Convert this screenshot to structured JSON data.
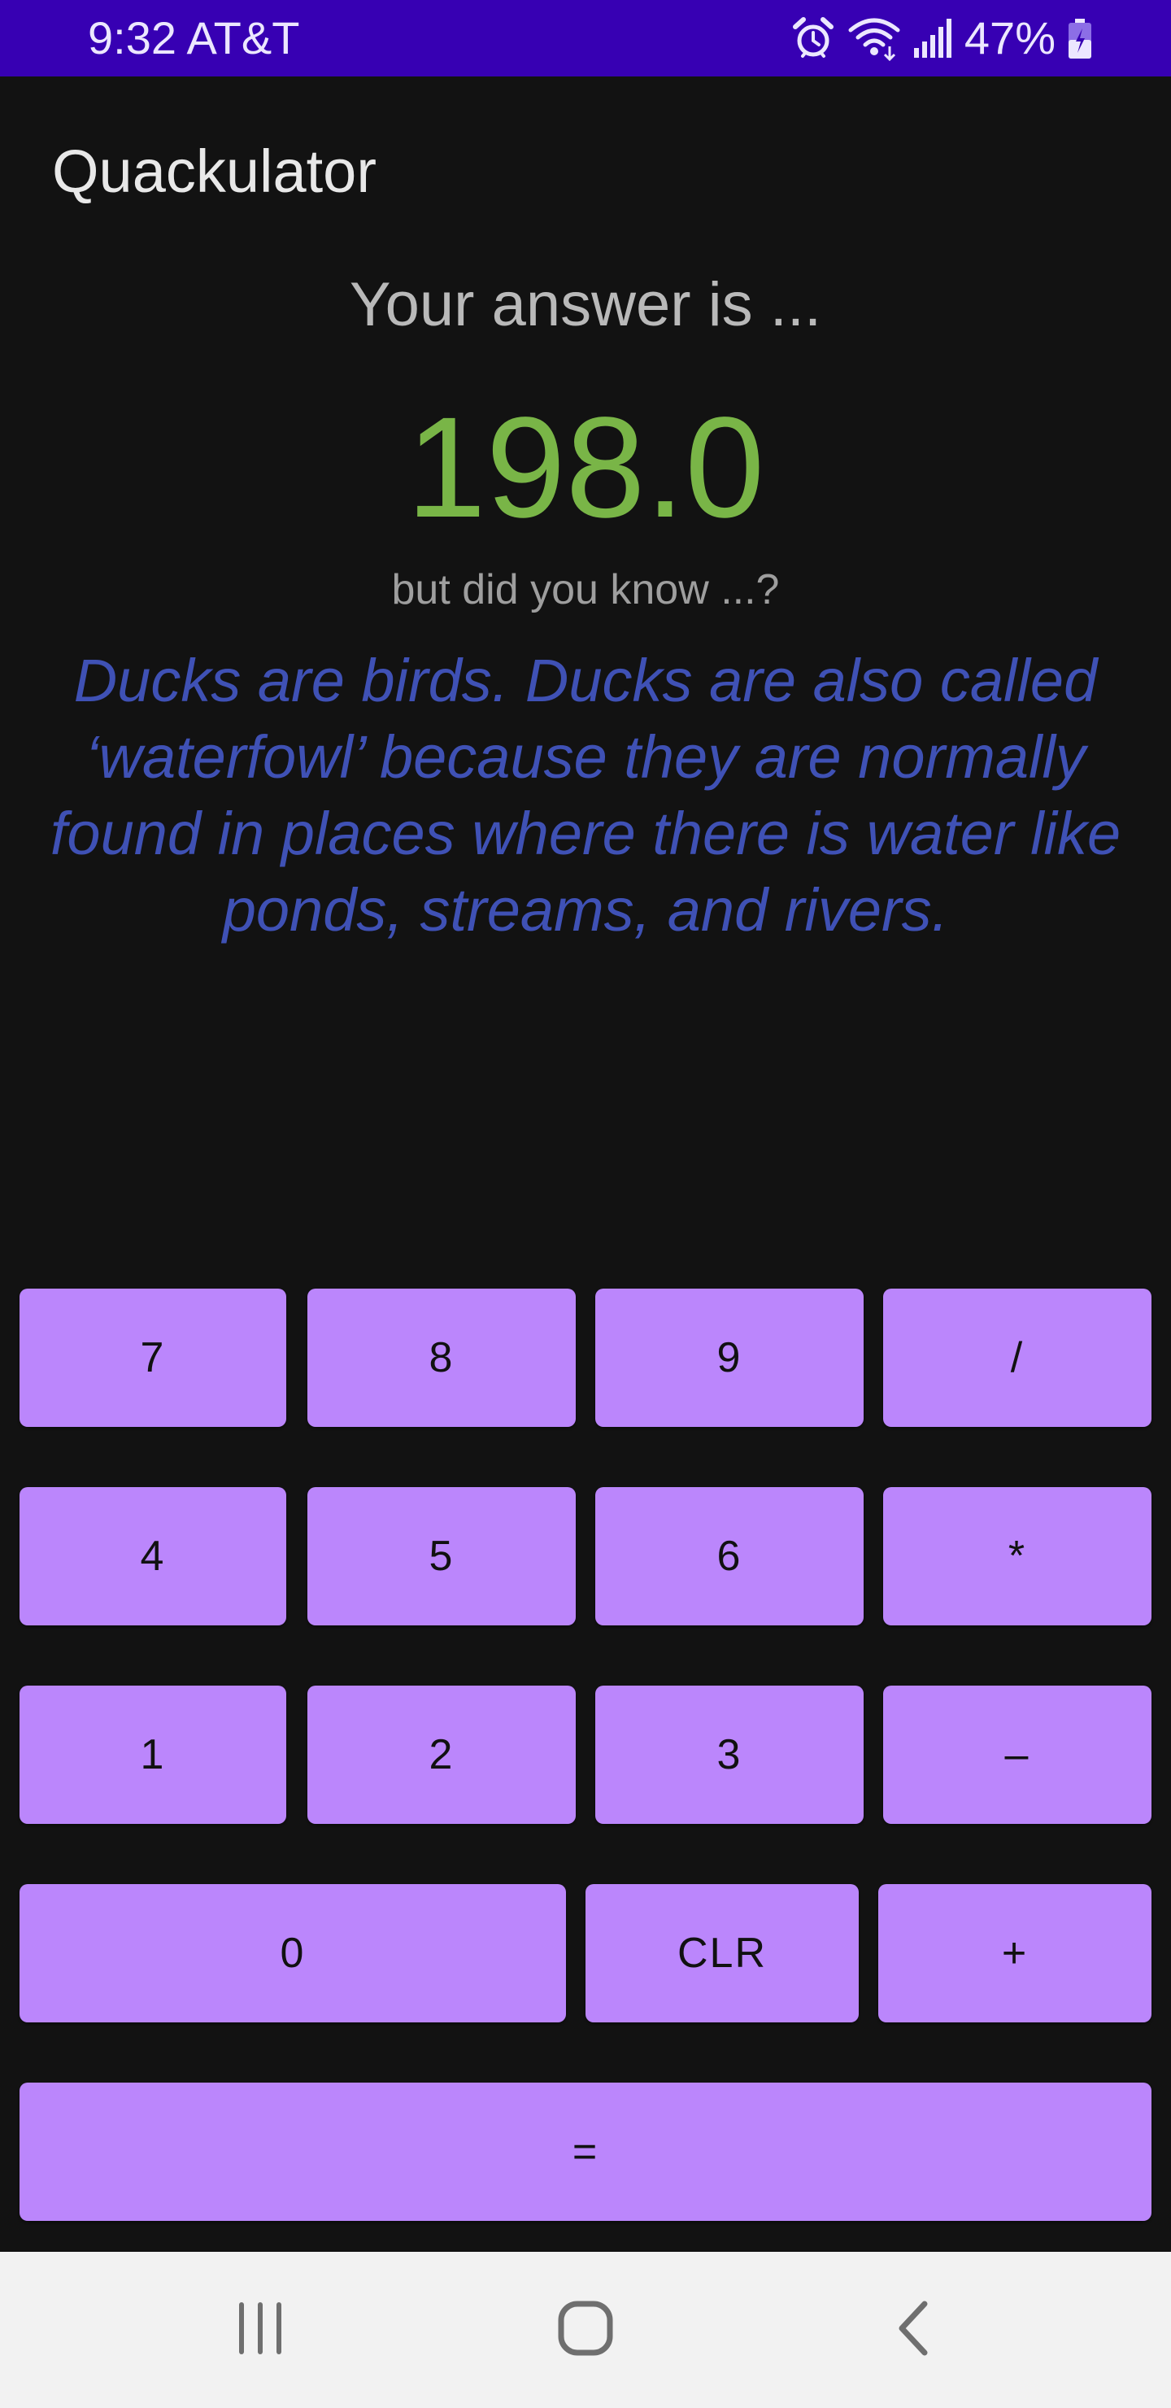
{
  "status_bar": {
    "time_carrier": "9:32 AT&T",
    "battery_percent": "47%",
    "icons": [
      "alarm-icon",
      "wifi-icon",
      "signal-icon",
      "battery-icon"
    ]
  },
  "app": {
    "title": "Quackulator"
  },
  "result": {
    "heading": "Your answer is ...",
    "value": "198.0",
    "fact_intro": "but did you know ...?",
    "fact": "Ducks are birds. Ducks are also called ‘waterfowl’ because they are normally found in places where there is water like ponds, streams, and rivers."
  },
  "keypad": {
    "row1": [
      "7",
      "8",
      "9",
      "/"
    ],
    "row2": [
      "4",
      "5",
      "6",
      "*"
    ],
    "row3": [
      "1",
      "2",
      "3",
      "–"
    ],
    "row4": [
      "0",
      "CLR",
      "+"
    ],
    "equals": "="
  },
  "nav_bar": {
    "icons": [
      "recent-apps-icon",
      "home-icon",
      "back-icon"
    ]
  },
  "colors": {
    "status_bar": "#3700b3",
    "background": "#121212",
    "answer_value": "#79b547",
    "fact_text": "#3f51b5",
    "key_fill": "#bb86fc",
    "nav_bar": "#f2f2f2"
  }
}
